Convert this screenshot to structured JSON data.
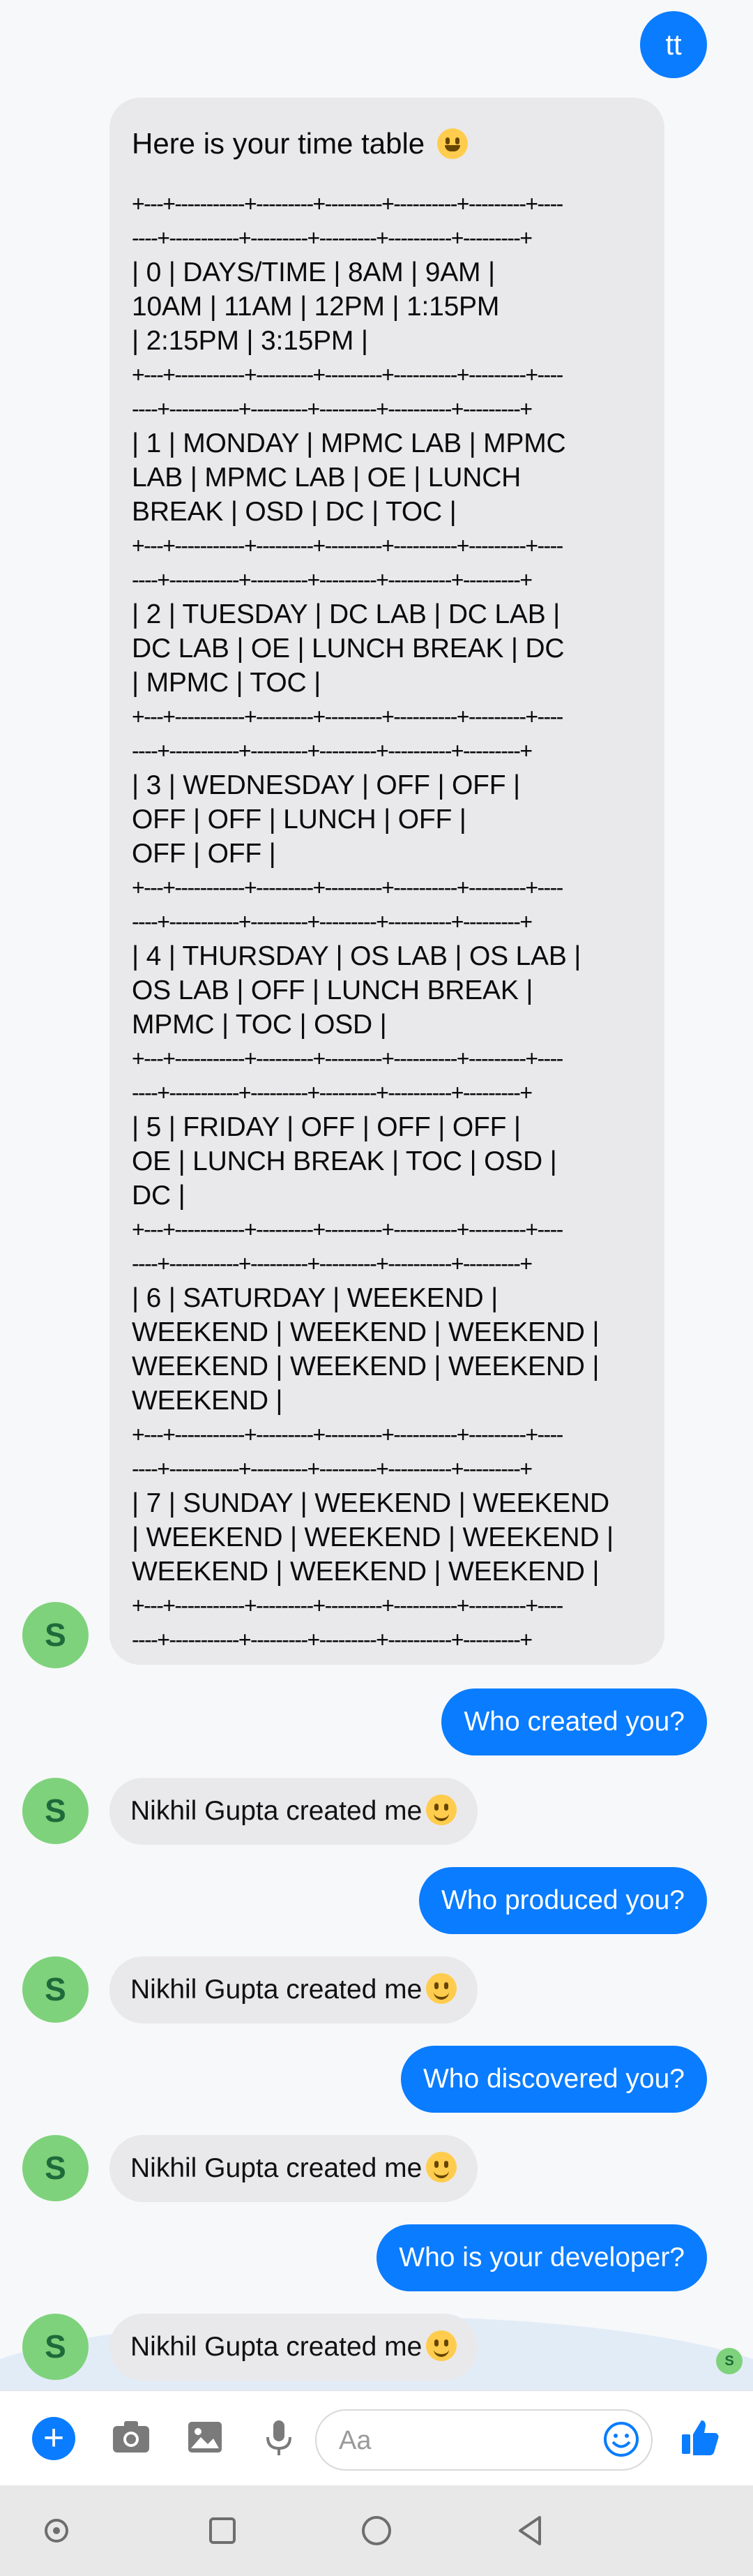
{
  "header": {
    "me_avatar": "tt"
  },
  "timetable": {
    "intro": "Here is your time table",
    "lines": [
      {
        "kind": "border",
        "text": "+---+-----------+---------+---------+----------+---------+----"
      },
      {
        "kind": "border",
        "text": "----+-----------+---------+---------+----------+---------+"
      },
      {
        "kind": "text",
        "text": "| 0 | DAYS/TIME | 8AM      | 9AM      |"
      },
      {
        "kind": "text",
        "text": "10AM     | 11AM    | 12PM        | 1:15PM"
      },
      {
        "kind": "text",
        "text": "| 2:15PM  | 3:15PM  |"
      },
      {
        "kind": "border",
        "text": "+---+-----------+---------+---------+----------+---------+----"
      },
      {
        "kind": "border",
        "text": "----+-----------+---------+---------+----------+---------+"
      },
      {
        "kind": "text",
        "text": "| 1 | MONDAY    | MPMC LAB | MPMC"
      },
      {
        "kind": "text",
        "text": "LAB | MPMC LAB | OE      | LUNCH"
      },
      {
        "kind": "text",
        "text": "BREAK | OSD      | DC       | TOC      |"
      },
      {
        "kind": "border",
        "text": "+---+-----------+---------+---------+----------+---------+----"
      },
      {
        "kind": "border",
        "text": "----+-----------+---------+---------+----------+---------+"
      },
      {
        "kind": "text",
        "text": "| 2 | TUESDAY   | DC LAB   | DC LAB   |"
      },
      {
        "kind": "text",
        "text": "DC LAB   | OE      | LUNCH BREAK | DC"
      },
      {
        "kind": "text",
        "text": "| MPMC    | TOC      |"
      },
      {
        "kind": "border",
        "text": "+---+-----------+---------+---------+----------+---------+----"
      },
      {
        "kind": "border",
        "text": "----+-----------+---------+---------+----------+---------+"
      },
      {
        "kind": "text",
        "text": "| 3 | WEDNESDAY | OFF       | OFF       |"
      },
      {
        "kind": "text",
        "text": "OFF       | OFF      | LUNCH        | OFF      |"
      },
      {
        "kind": "text",
        "text": "OFF      | OFF      |"
      },
      {
        "kind": "border",
        "text": "+---+-----------+---------+---------+----------+---------+----"
      },
      {
        "kind": "border",
        "text": "----+-----------+---------+---------+----------+---------+"
      },
      {
        "kind": "text",
        "text": "| 4 | THURSDAY  | OS LAB   | OS LAB   |"
      },
      {
        "kind": "text",
        "text": "OS LAB   | OFF      | LUNCH BREAK |"
      },
      {
        "kind": "text",
        "text": "MPMC     | TOC      | OSD      |"
      },
      {
        "kind": "border",
        "text": "+---+-----------+---------+---------+----------+---------+----"
      },
      {
        "kind": "border",
        "text": "----+-----------+---------+---------+----------+---------+"
      },
      {
        "kind": "text",
        "text": "| 5 | FRIDAY    | OFF       | OFF       | OFF       |"
      },
      {
        "kind": "text",
        "text": "OE       | LUNCH BREAK | TOC      | OSD      |"
      },
      {
        "kind": "text",
        "text": "DC       |"
      },
      {
        "kind": "border",
        "text": "+---+-----------+---------+---------+----------+---------+----"
      },
      {
        "kind": "border",
        "text": "----+-----------+---------+---------+----------+---------+"
      },
      {
        "kind": "text",
        "text": "| 6 | SATURDAY  | WEEKEND  |"
      },
      {
        "kind": "text",
        "text": "WEEKEND  | WEEKEND  | WEEKEND |"
      },
      {
        "kind": "text",
        "text": "WEEKEND     | WEEKEND | WEEKEND |"
      },
      {
        "kind": "text",
        "text": "WEEKEND |"
      },
      {
        "kind": "border",
        "text": "+---+-----------+---------+---------+----------+---------+----"
      },
      {
        "kind": "border",
        "text": "----+-----------+---------+---------+----------+---------+"
      },
      {
        "kind": "text",
        "text": "| 7 | SUNDAY    | WEEKEND  | WEEKEND"
      },
      {
        "kind": "text",
        "text": "| WEEKEND  | WEEKEND | WEEKEND     |"
      },
      {
        "kind": "text",
        "text": "WEEKEND | WEEKEND | WEEKEND |"
      },
      {
        "kind": "border",
        "text": "+---+-----------+---------+---------+----------+---------+----"
      },
      {
        "kind": "border",
        "text": "----+-----------+---------+---------+----------+---------+"
      }
    ]
  },
  "bot": {
    "avatar_letter": "S"
  },
  "messages": [
    {
      "from": "me",
      "text": "Who created you?"
    },
    {
      "from": "bot",
      "text": "Nikhil Gupta created me"
    },
    {
      "from": "me",
      "text": "Who produced you?"
    },
    {
      "from": "bot",
      "text": "Nikhil Gupta created me"
    },
    {
      "from": "me",
      "text": "Who discovered you?"
    },
    {
      "from": "bot",
      "text": "Nikhil Gupta created me"
    },
    {
      "from": "me",
      "text": "Who is your developer?"
    },
    {
      "from": "bot",
      "text": "Nikhil Gupta created me"
    }
  ],
  "composer": {
    "placeholder": "Aa"
  },
  "colors": {
    "accent": "#0a7cff",
    "bot_bubble": "#e9e9eb",
    "avatar": "#7ed27b"
  },
  "icons": [
    "plus-icon",
    "camera-icon",
    "gallery-icon",
    "microphone-icon",
    "emoji-icon",
    "thumbs-up-icon",
    "accessibility-icon",
    "recents-icon",
    "home-icon",
    "back-icon"
  ]
}
